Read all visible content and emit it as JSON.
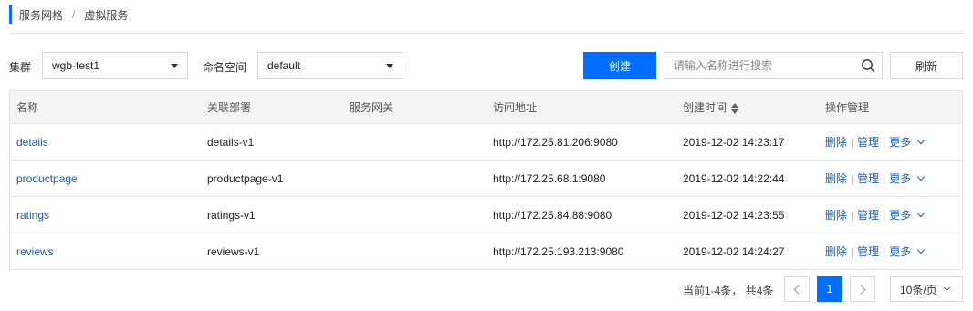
{
  "breadcrumb": {
    "parent": "服务网格",
    "separator": "/",
    "current": "虚拟服务"
  },
  "filters": {
    "cluster_label": "集群",
    "cluster_value": "wgb-test1",
    "namespace_label": "命名空间",
    "namespace_value": "default"
  },
  "actions": {
    "create_label": "创建",
    "search_placeholder": "请输入名称进行搜索",
    "refresh_label": "刷新"
  },
  "table": {
    "headers": [
      "名称",
      "关联部署",
      "服务网关",
      "访问地址",
      "创建时间",
      "操作管理"
    ],
    "rows": [
      {
        "name": "details",
        "deployment": "details-v1",
        "gateway": "",
        "address": "http://172.25.81.206:9080",
        "created": "2019-12-02 14:23:17"
      },
      {
        "name": "productpage",
        "deployment": "productpage-v1",
        "gateway": "",
        "address": "http://172.25.68.1:9080",
        "created": "2019-12-02 14:22:44"
      },
      {
        "name": "ratings",
        "deployment": "ratings-v1",
        "gateway": "",
        "address": "http://172.25.84.88:9080",
        "created": "2019-12-02 14:23:55"
      },
      {
        "name": "reviews",
        "deployment": "reviews-v1",
        "gateway": "",
        "address": "http://172.25.193.213:9080",
        "created": "2019-12-02 14:24:27"
      }
    ],
    "ops": {
      "delete": "删除",
      "manage": "管理",
      "more": "更多",
      "divider": "|"
    }
  },
  "pagination": {
    "total_text": "当前1-4条， 共4条",
    "current_page": "1",
    "page_size": "10条/页"
  },
  "colors": {
    "accent": "#006eff",
    "link": "#1c5eab"
  }
}
